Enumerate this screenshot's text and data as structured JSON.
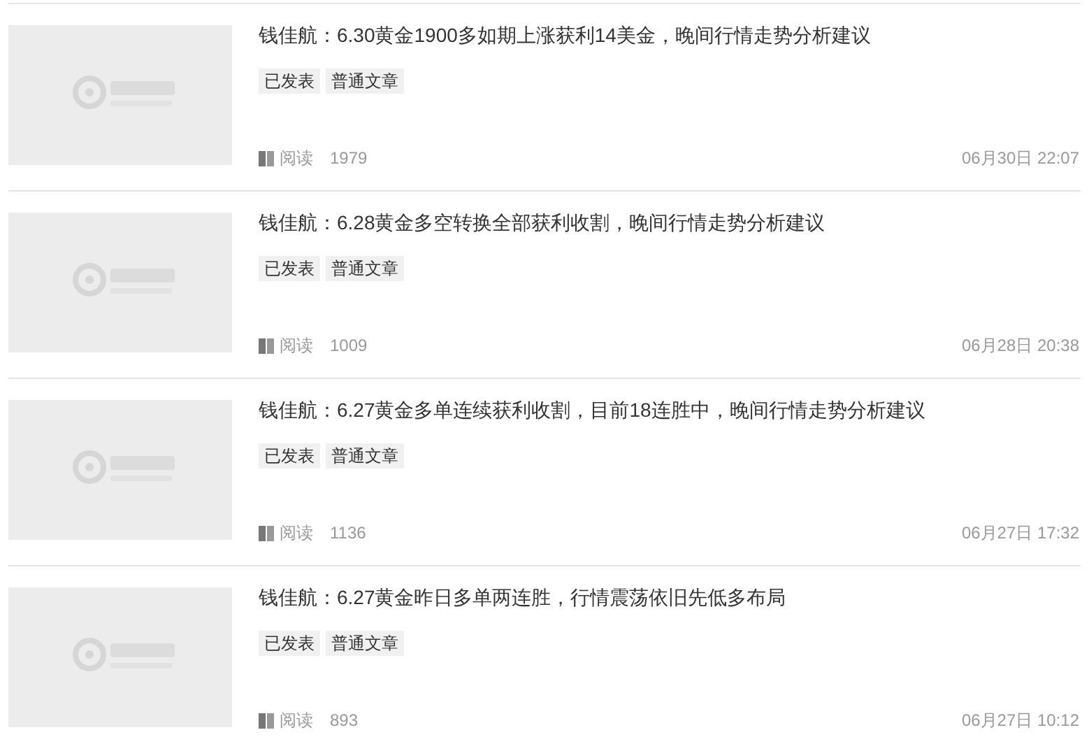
{
  "articles": [
    {
      "title": "钱佳航：6.30黄金1900多如期上涨获利14美金，晚间行情走势分析建议",
      "tags": [
        "已发表",
        "普通文章"
      ],
      "read_label": "阅读",
      "read_count": "1979",
      "date": "06月30日 22:07"
    },
    {
      "title": "钱佳航：6.28黄金多空转换全部获利收割，晚间行情走势分析建议",
      "tags": [
        "已发表",
        "普通文章"
      ],
      "read_label": "阅读",
      "read_count": "1009",
      "date": "06月28日 20:38"
    },
    {
      "title": "钱佳航：6.27黄金多单连续获利收割，目前18连胜中，晚间行情走势分析建议",
      "tags": [
        "已发表",
        "普通文章"
      ],
      "read_label": "阅读",
      "read_count": "1136",
      "date": "06月27日 17:32"
    },
    {
      "title": "钱佳航：6.27黄金昨日多单两连胜，行情震荡依旧先低多布局",
      "tags": [
        "已发表",
        "普通文章"
      ],
      "read_label": "阅读",
      "read_count": "893",
      "date": "06月27日 10:12"
    }
  ]
}
